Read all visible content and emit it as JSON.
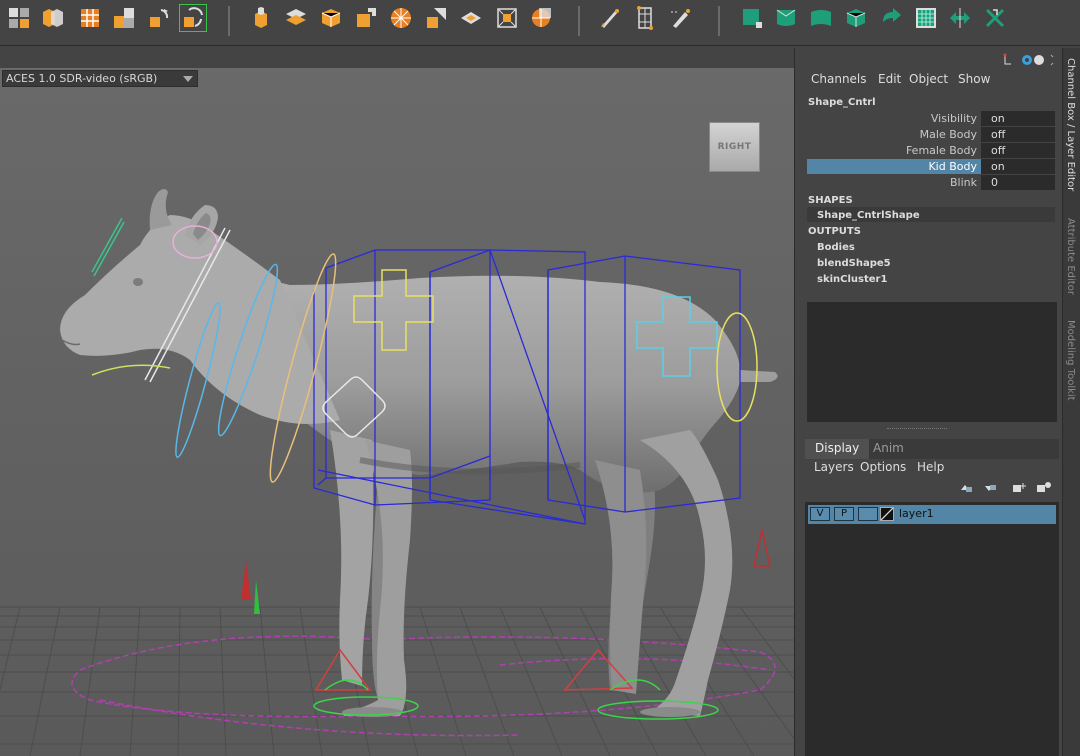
{
  "toolbar": {
    "icons": [
      "move-tool-icon",
      "multi-cube-icon",
      "grid-select-icon",
      "snap-grid-icon",
      "rotate-snap-icon",
      "reset-rotation-icon",
      "extrude-icon",
      "bevel-icon",
      "cube-face-icon",
      "cut-faces-icon",
      "sphere-wireframe-icon",
      "plane-cut-icon",
      "flat-plane-icon",
      "scale-box-icon",
      "sphere-grid-icon",
      "paint-icon",
      "lattice-icon",
      "pen-tool-icon",
      "uv-square-icon",
      "uv-shell-icon",
      "uv-unfold-icon",
      "uv-cube-icon",
      "uv-rotate-icon",
      "uv-checker-icon",
      "uv-scale-icon",
      "uv-cut-icon"
    ],
    "accent_color": "#3bc44b"
  },
  "viewport": {
    "color_space": "ACES 1.0 SDR-video (sRGB)",
    "view_cube_label": "RIGHT"
  },
  "channel_box": {
    "menu": [
      "Channels",
      "Edit",
      "Object",
      "Show"
    ],
    "node_name": "Shape_Cntrl",
    "attributes": [
      {
        "name": "Visibility",
        "value": "on",
        "selected": false
      },
      {
        "name": "Male Body",
        "value": "off",
        "selected": false
      },
      {
        "name": "Female Body",
        "value": "off",
        "selected": false
      },
      {
        "name": "Kid Body",
        "value": "on",
        "selected": true
      },
      {
        "name": "Blink",
        "value": "0",
        "selected": false
      }
    ],
    "shapes_header": "SHAPES",
    "shapes": [
      "Shape_CntrlShape"
    ],
    "outputs_header": "OUTPUTS",
    "outputs": [
      "Bodies",
      "blendShape5",
      "skinCluster1"
    ],
    "selection_color": "#5285a6"
  },
  "layer_editor": {
    "tabs": [
      {
        "label": "Display",
        "active": true
      },
      {
        "label": "Anim",
        "active": false
      }
    ],
    "menu": [
      "Layers",
      "Options",
      "Help"
    ],
    "layers": [
      {
        "visible_label": "V",
        "playback_label": "P",
        "name": "layer1"
      }
    ]
  },
  "side_tabs": [
    "Channel Box / Layer Editor",
    "Attribute Editor",
    "Modeling Toolkit"
  ]
}
